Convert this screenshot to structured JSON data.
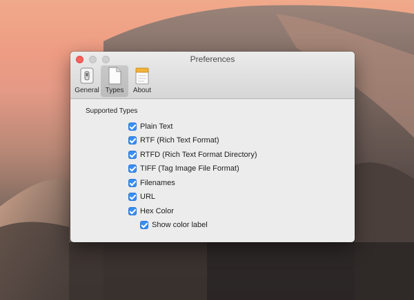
{
  "window": {
    "title": "Preferences"
  },
  "toolbar": {
    "items": [
      {
        "label": "General",
        "icon": "general-switch-icon",
        "selected": false
      },
      {
        "label": "Types",
        "icon": "document-icon",
        "selected": true
      },
      {
        "label": "About",
        "icon": "notes-icon",
        "selected": false
      }
    ]
  },
  "types": {
    "section_label": "Supported Types",
    "options": [
      {
        "label": "Plain Text",
        "checked": true
      },
      {
        "label": "RTF (Rich Text Format)",
        "checked": true
      },
      {
        "label": "RTFD (Rich Text Format Directory)",
        "checked": true
      },
      {
        "label": "TIFF (Tag Image File Format)",
        "checked": true
      },
      {
        "label": "Filenames",
        "checked": true
      },
      {
        "label": "URL",
        "checked": true
      },
      {
        "label": "Hex Color",
        "checked": true
      }
    ],
    "sub_option": {
      "label": "Show color label",
      "checked": true
    }
  },
  "colors": {
    "checkbox_accent": "#3a8ef3",
    "close_button": "#fc605c"
  }
}
